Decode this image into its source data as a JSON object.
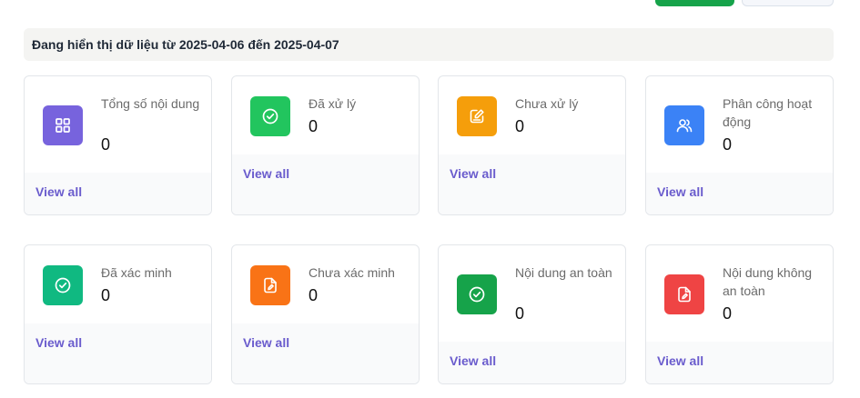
{
  "banner": {
    "text": "Đang hiển thị dữ liệu từ 2025-04-06 đến 2025-04-07"
  },
  "cards": [
    {
      "title": "Tổng số nội dung",
      "count": "0",
      "link": "View all",
      "icon": "grid-icon",
      "color": "#7763dd"
    },
    {
      "title": "Đã xử lý",
      "count": "0",
      "link": "View all",
      "icon": "check-circle-icon",
      "color": "#22c55e"
    },
    {
      "title": "Chưa xử lý",
      "count": "0",
      "link": "View all",
      "icon": "edit-note-icon",
      "color": "#f59e0b"
    },
    {
      "title": "Phân công hoạt động",
      "count": "0",
      "link": "View all",
      "icon": "users-icon",
      "color": "#3b82f6"
    },
    {
      "title": "Đã xác minh",
      "count": "0",
      "link": "View all",
      "icon": "check-circle-icon",
      "color": "#10b981"
    },
    {
      "title": "Chưa xác minh",
      "count": "0",
      "link": "View all",
      "icon": "file-edit-icon",
      "color": "#f97316"
    },
    {
      "title": "Nội dung an toàn",
      "count": "0",
      "link": "View all",
      "icon": "check-circle-icon",
      "color": "#16a34a"
    },
    {
      "title": "Nội dung không an toàn",
      "count": "0",
      "link": "View all",
      "icon": "file-edit-icon",
      "color": "#ef4444"
    }
  ]
}
